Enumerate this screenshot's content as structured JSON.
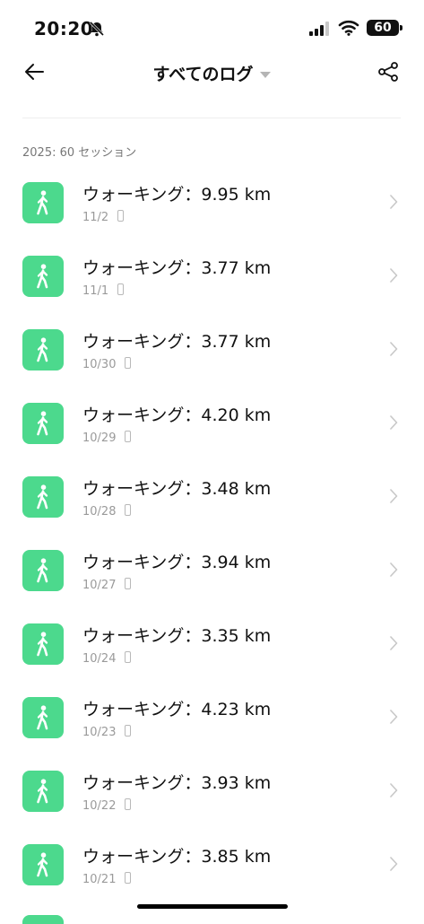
{
  "status_bar": {
    "time": "20:20",
    "battery": "60"
  },
  "nav": {
    "title": "すべてのログ"
  },
  "section": {
    "header": "2025: 60 セッション"
  },
  "activities": [
    {
      "title": "ウォーキング：9.95 km",
      "date": "11/2"
    },
    {
      "title": "ウォーキング：3.77 km",
      "date": "11/1"
    },
    {
      "title": "ウォーキング：3.77 km",
      "date": "10/30"
    },
    {
      "title": "ウォーキング：4.20 km",
      "date": "10/29"
    },
    {
      "title": "ウォーキング：3.48 km",
      "date": "10/28"
    },
    {
      "title": "ウォーキング：3.94 km",
      "date": "10/27"
    },
    {
      "title": "ウォーキング：3.35 km",
      "date": "10/24"
    },
    {
      "title": "ウォーキング：4.23 km",
      "date": "10/23"
    },
    {
      "title": "ウォーキング：3.93 km",
      "date": "10/22"
    },
    {
      "title": "ウォーキング：3.85 km",
      "date": "10/21"
    }
  ],
  "icons": {
    "activity": "walking-person-icon",
    "back": "back-arrow-icon",
    "share": "share-icon",
    "row_chevron": "chevron-right-icon",
    "device": "phone-device-icon",
    "mute": "bell-slash-icon"
  },
  "colors": {
    "activity_icon_bg": "#4cd98d",
    "text_primary": "#111111",
    "text_secondary": "#9a9a9a"
  }
}
